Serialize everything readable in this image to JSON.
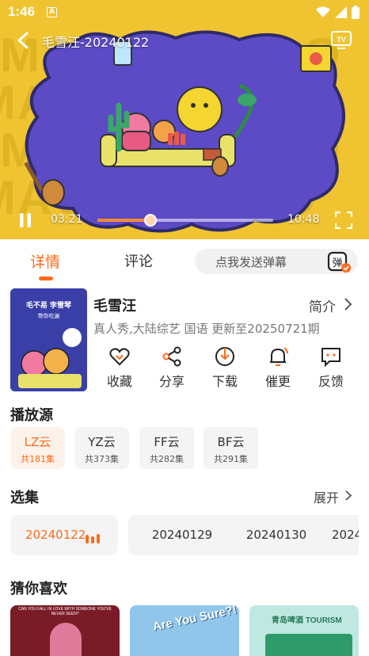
{
  "status_bar": {
    "time": "1:46",
    "notification_glyph": "A"
  },
  "player": {
    "title": "毛雪汪-20240122",
    "background_text": "MAOXUEWOO",
    "current_time": "03:21",
    "total_time": "10:48",
    "progress": 0.3,
    "is_playing": true
  },
  "tabs": {
    "detail": "详情",
    "comment": "评论",
    "active": "detail"
  },
  "danmaku": {
    "placeholder": "点我发送弹幕",
    "icon_char": "弹"
  },
  "show": {
    "title": "毛雪汪",
    "intro_label": "简介",
    "meta": "真人秀,大陆综艺 国语 更新至20250721期",
    "poster": {
      "line1": "毛不易 李雪琴",
      "line2": "带你吃遍"
    }
  },
  "actions": [
    {
      "label": "收藏",
      "icon": "heart-icon"
    },
    {
      "label": "分享",
      "icon": "share-icon"
    },
    {
      "label": "下载",
      "icon": "download-icon"
    },
    {
      "label": "催更",
      "icon": "bell-icon"
    },
    {
      "label": "反馈",
      "icon": "feedback-icon"
    }
  ],
  "sources": {
    "title": "播放源",
    "items": [
      {
        "name": "LZ云",
        "count": "共181集",
        "active": true
      },
      {
        "name": "YZ云",
        "count": "共373集",
        "active": false
      },
      {
        "name": "FF云",
        "count": "共282集",
        "active": false
      },
      {
        "name": "BF云",
        "count": "共291集",
        "active": false
      }
    ]
  },
  "episodes": {
    "title": "选集",
    "expand_label": "展开",
    "items": [
      {
        "label": "20240122",
        "active": true
      },
      {
        "label": "20240129",
        "active": false
      },
      {
        "label": "20240130",
        "active": false
      },
      {
        "label": "2024",
        "active": false
      }
    ]
  },
  "recommend": {
    "title": "猜你喜欢",
    "items": [
      {
        "caption": "CAN YOU FALL IN LOVE WITH SOMEONE YOU'VE NEVER SEEN?"
      },
      {
        "caption": "Are You Sure?!"
      },
      {
        "caption": "青岛啤酒 TOURISM"
      }
    ]
  },
  "colors": {
    "accent": "#ff6a1a",
    "player_bg": "#f0c430",
    "cloud": "#5c4bc4"
  }
}
